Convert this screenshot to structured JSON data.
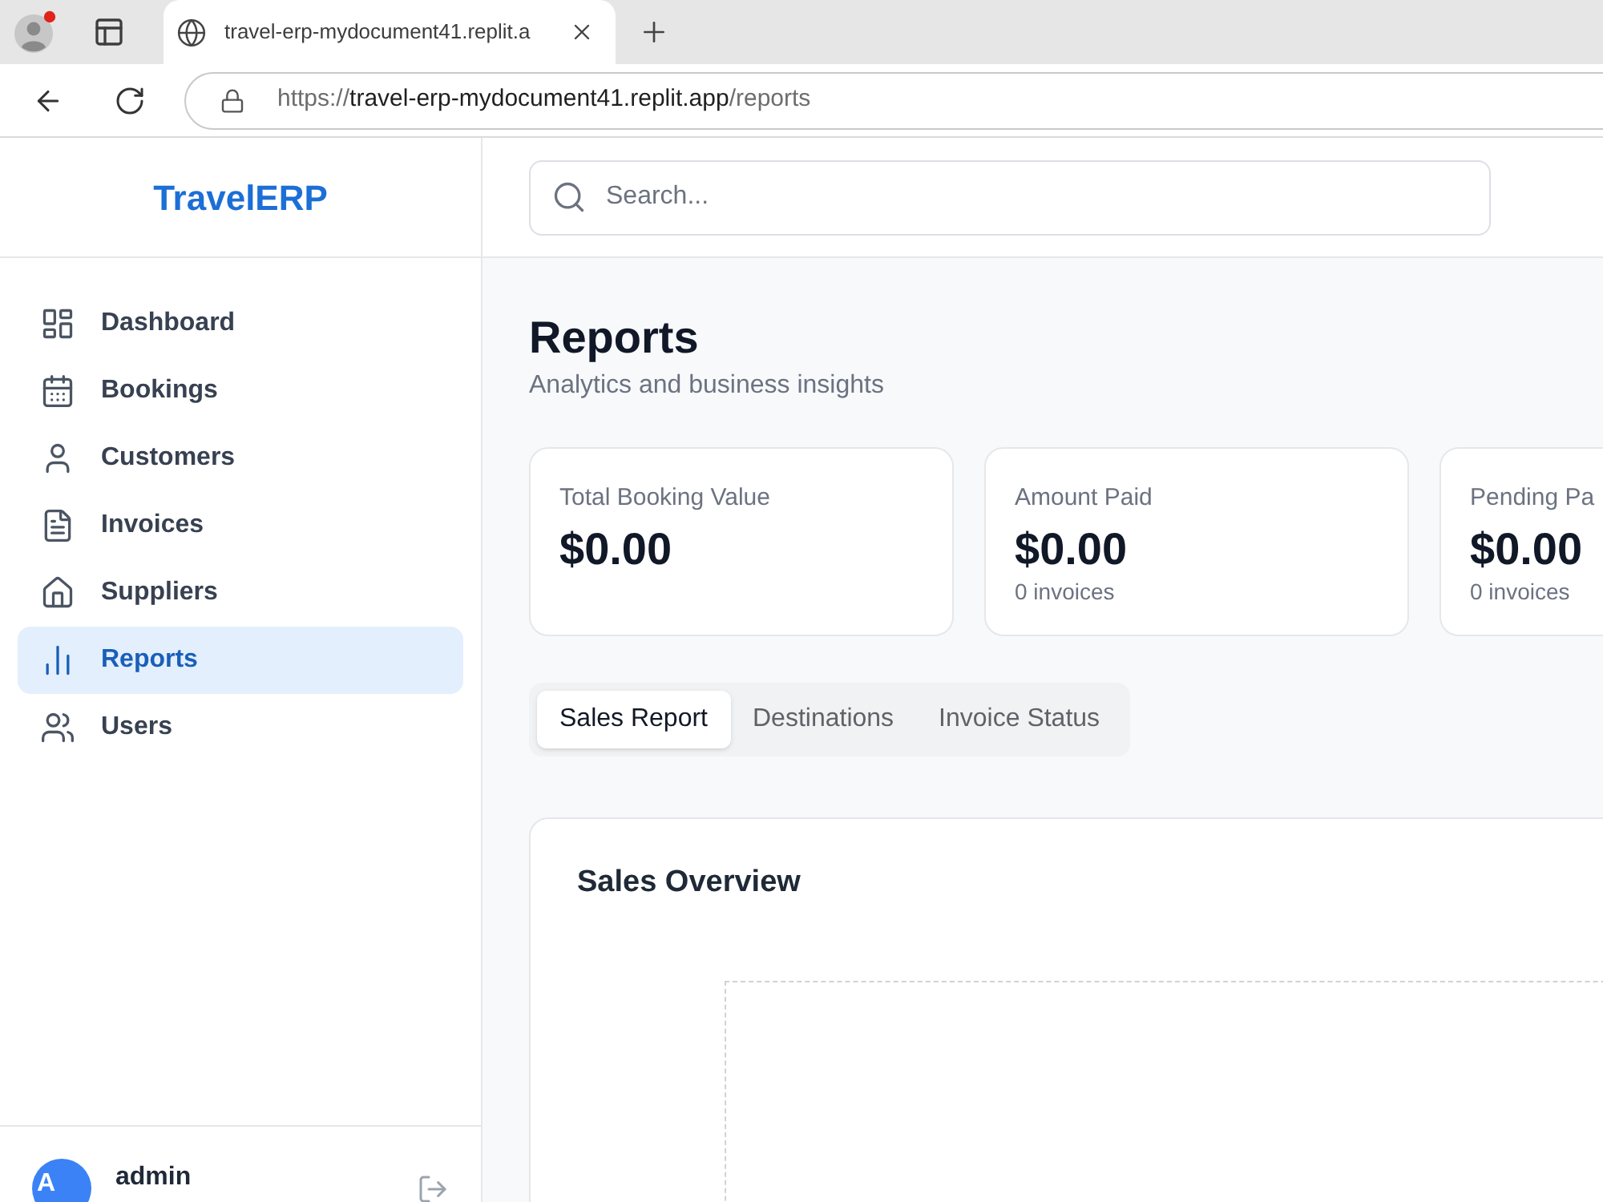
{
  "browser": {
    "tabs": [
      {
        "title": "travel-erp-mydocument41.replit.a",
        "selected": true
      }
    ],
    "address": {
      "scheme": "https://",
      "host": "travel-erp-mydocument41.replit.app",
      "path": "/reports"
    }
  },
  "sidebar": {
    "logo": "TravelERP",
    "items": [
      {
        "label": "Dashboard",
        "selected": false
      },
      {
        "label": "Bookings",
        "selected": false
      },
      {
        "label": "Customers",
        "selected": false
      },
      {
        "label": "Invoices",
        "selected": false
      },
      {
        "label": "Suppliers",
        "selected": false
      },
      {
        "label": "Reports",
        "selected": true
      },
      {
        "label": "Users",
        "selected": false
      }
    ],
    "user": {
      "initial": "A",
      "name": "admin"
    }
  },
  "search": {
    "placeholder": "Search..."
  },
  "page": {
    "title": "Reports",
    "subtitle": "Analytics and business insights"
  },
  "stats": [
    {
      "label": "Total Booking Value",
      "value": "$0.00"
    },
    {
      "label": "Amount Paid",
      "value": "$0.00",
      "note": "0 invoices"
    },
    {
      "label": "Pending Pa",
      "value": "$0.00",
      "note": "0 invoices"
    }
  ],
  "report_tabs": [
    {
      "label": "Sales Report",
      "selected": true
    },
    {
      "label": "Destinations",
      "selected": false
    },
    {
      "label": "Invoice Status",
      "selected": false
    }
  ],
  "chart_card": {
    "title": "Sales Overview"
  }
}
